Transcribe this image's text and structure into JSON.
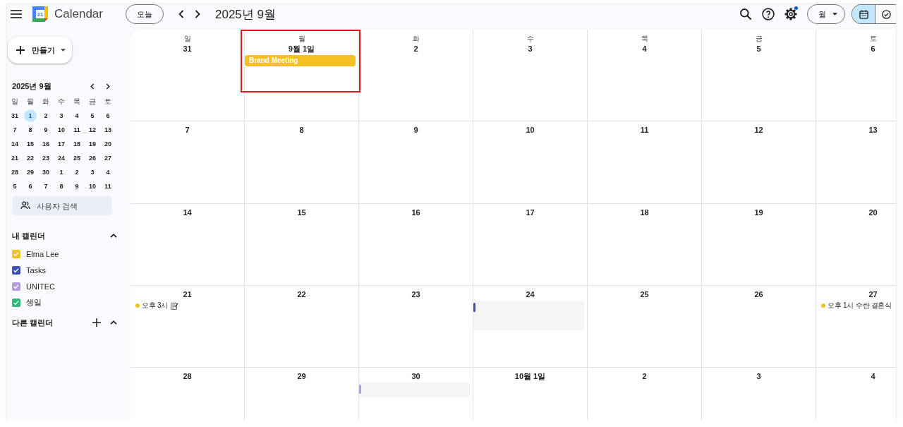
{
  "header": {
    "title": "Calendar",
    "logo_text": "21",
    "today_button": "오늘",
    "period": "2025년 9월",
    "actions": [
      {
        "kind": "search",
        "badge": false
      },
      {
        "kind": "help",
        "badge": false
      },
      {
        "kind": "settings",
        "badge": true
      }
    ],
    "view_dropdown": "월",
    "view_toggle": [
      {
        "kind": "calendar",
        "selected": true
      },
      {
        "kind": "tasks",
        "selected": false
      }
    ]
  },
  "sidebar": {
    "create_button": "만들기",
    "mini_calendar": {
      "title": "2025년 9월",
      "weekdays": [
        "일",
        "월",
        "화",
        "수",
        "목",
        "금",
        "토"
      ],
      "weeks": [
        [
          {
            "day": "31",
            "selected": false
          },
          {
            "day": "1",
            "selected": true
          },
          {
            "day": "2",
            "selected": false
          },
          {
            "day": "3",
            "selected": false
          },
          {
            "day": "4",
            "selected": false
          },
          {
            "day": "5",
            "selected": false
          },
          {
            "day": "6",
            "selected": false
          }
        ],
        [
          {
            "day": "7",
            "selected": false
          },
          {
            "day": "8",
            "selected": false
          },
          {
            "day": "9",
            "selected": false
          },
          {
            "day": "10",
            "selected": false
          },
          {
            "day": "11",
            "selected": false
          },
          {
            "day": "12",
            "selected": false
          },
          {
            "day": "13",
            "selected": false
          }
        ],
        [
          {
            "day": "14",
            "selected": false
          },
          {
            "day": "15",
            "selected": false
          },
          {
            "day": "16",
            "selected": false
          },
          {
            "day": "17",
            "selected": false
          },
          {
            "day": "18",
            "selected": false
          },
          {
            "day": "19",
            "selected": false
          },
          {
            "day": "20",
            "selected": false
          }
        ],
        [
          {
            "day": "21",
            "selected": false
          },
          {
            "day": "22",
            "selected": false
          },
          {
            "day": "23",
            "selected": false
          },
          {
            "day": "24",
            "selected": false
          },
          {
            "day": "25",
            "selected": false
          },
          {
            "day": "26",
            "selected": false
          },
          {
            "day": "27",
            "selected": false
          }
        ],
        [
          {
            "day": "28",
            "selected": false
          },
          {
            "day": "29",
            "selected": false
          },
          {
            "day": "30",
            "selected": false
          },
          {
            "day": "1",
            "selected": false
          },
          {
            "day": "2",
            "selected": false
          },
          {
            "day": "3",
            "selected": false
          },
          {
            "day": "4",
            "selected": false
          }
        ],
        [
          {
            "day": "5",
            "selected": false
          },
          {
            "day": "6",
            "selected": false
          },
          {
            "day": "7",
            "selected": false
          },
          {
            "day": "8",
            "selected": false
          },
          {
            "day": "9",
            "selected": false
          },
          {
            "day": "10",
            "selected": false
          },
          {
            "day": "11",
            "selected": false
          }
        ]
      ]
    },
    "people_search": {
      "placeholder": "사용자 검색"
    },
    "my_calendars": {
      "title": "내 캘린더",
      "expanded": true,
      "items": [
        {
          "label": "Elma Lee",
          "color": "#f6bf26",
          "checked": true
        },
        {
          "label": "Tasks",
          "color": "#3f51b5",
          "checked": true
        },
        {
          "label": "UNITEC",
          "color": "#b39ddb",
          "checked": true
        },
        {
          "label": "생일",
          "color": "#33b679",
          "checked": true
        }
      ]
    },
    "other_calendars": {
      "title": "다른 캘린더",
      "expanded": true
    }
  },
  "month_grid": {
    "weekdays": [
      "일",
      "월",
      "화",
      "수",
      "목",
      "금",
      "토"
    ],
    "weeks": [
      {
        "days": [
          {
            "date": "31",
            "outlined": false
          },
          {
            "date": "9월 1일",
            "outlined": true,
            "events": [
              {
                "kind": "chip",
                "title": "Brand Meeting",
                "color": "#f6bf26"
              }
            ]
          },
          {
            "date": "2",
            "outlined": false
          },
          {
            "date": "3",
            "outlined": false
          },
          {
            "date": "4",
            "outlined": false
          },
          {
            "date": "5",
            "outlined": false
          },
          {
            "date": "6",
            "outlined": false
          }
        ]
      },
      {
        "days": [
          {
            "date": "7",
            "outlined": false
          },
          {
            "date": "8",
            "outlined": false
          },
          {
            "date": "9",
            "outlined": false
          },
          {
            "date": "10",
            "outlined": false
          },
          {
            "date": "11",
            "outlined": false
          },
          {
            "date": "12",
            "outlined": false
          },
          {
            "date": "13",
            "outlined": false
          }
        ]
      },
      {
        "days": [
          {
            "date": "14",
            "outlined": false
          },
          {
            "date": "15",
            "outlined": false
          },
          {
            "date": "16",
            "outlined": false
          },
          {
            "date": "17",
            "outlined": false
          },
          {
            "date": "18",
            "outlined": false
          },
          {
            "date": "19",
            "outlined": false
          },
          {
            "date": "20",
            "outlined": false
          }
        ]
      },
      {
        "days": [
          {
            "date": "21",
            "outlined": false,
            "events": [
              {
                "kind": "timed-note",
                "time": "오후 3시",
                "color": "#f6bf26"
              }
            ]
          },
          {
            "date": "22",
            "outlined": false
          },
          {
            "date": "23",
            "outlined": false
          },
          {
            "date": "24",
            "outlined": false,
            "events": [
              {
                "kind": "blank-tall",
                "color": "#3f51b5"
              }
            ]
          },
          {
            "date": "25",
            "outlined": false
          },
          {
            "date": "26",
            "outlined": false
          },
          {
            "date": "27",
            "outlined": false,
            "events": [
              {
                "kind": "timed",
                "time": "오후 1시",
                "title": "수란 결혼식",
                "color": "#f6bf26"
              }
            ]
          }
        ]
      },
      {
        "days": [
          {
            "date": "28",
            "outlined": false
          },
          {
            "date": "29",
            "outlined": false
          },
          {
            "date": "30",
            "outlined": false,
            "events": [
              {
                "kind": "blank",
                "color": "#b39ddb"
              }
            ]
          },
          {
            "date": "10월 1일",
            "outlined": false
          },
          {
            "date": "2",
            "outlined": false
          },
          {
            "date": "3",
            "outlined": false
          },
          {
            "date": "4",
            "outlined": false
          }
        ]
      }
    ]
  }
}
